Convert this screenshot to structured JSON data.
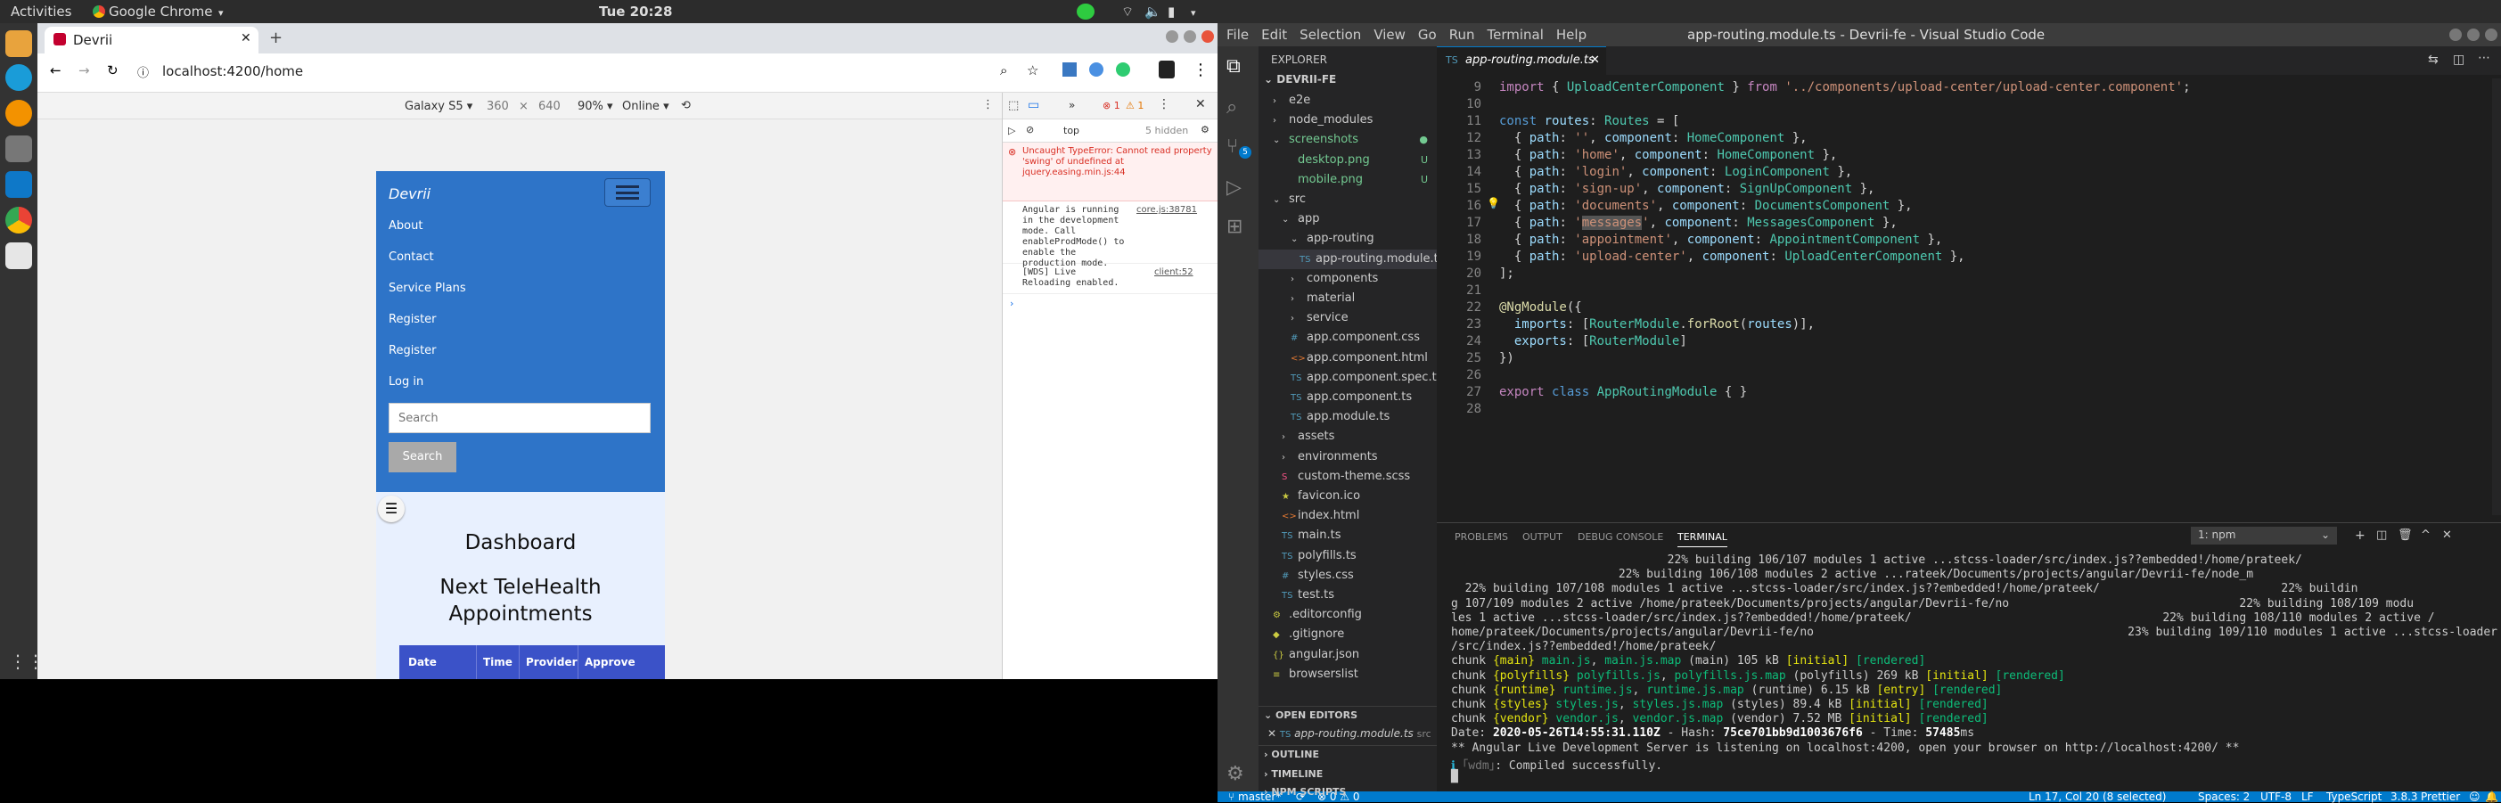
{
  "system": {
    "activities": "Activities",
    "app_name": "Google Chrome",
    "clock": "Tue 20:28"
  },
  "browser": {
    "tab_title": "Devrii",
    "url": "localhost:4200/home",
    "device": {
      "name": "Galaxy S5",
      "width": "360",
      "x": "×",
      "height": "640",
      "zoom": "90%",
      "network": "Online"
    },
    "devtools": {
      "context": "top",
      "hidden": "5 hidden",
      "errors": "1",
      "warnings": "1",
      "messages": [
        {
          "text": "Uncaught TypeError: Cannot read property 'swing' of undefined at jquery.easing.min.js:44",
          "source": "jquery.easing.min.js:44"
        },
        {
          "text": "Angular is running in the development mode. Call enableProdMode() to enable the production mode.",
          "source": "core.js:38781"
        },
        {
          "text": "[WDS] Live Reloading enabled.",
          "source": "client:52"
        }
      ]
    }
  },
  "app": {
    "brand": "Devrii",
    "nav": [
      "About",
      "Contact",
      "Service Plans",
      "Register",
      "Register",
      "Log in"
    ],
    "search_placeholder": "Search",
    "search_button": "Search",
    "dashboard_title": "Dashboard",
    "section_title_1": "Next TeleHealth",
    "section_title_2": "Appointments",
    "table_headers": [
      "Date",
      "Time",
      "Provider",
      "Approve"
    ]
  },
  "vscode": {
    "title": "app-routing.module.ts - Devrii-fe - Visual Studio Code",
    "menu": [
      "File",
      "Edit",
      "Selection",
      "View",
      "Go",
      "Run",
      "Terminal",
      "Help"
    ],
    "explorer_title": "EXPLORER",
    "project": "DEVRII-FE",
    "tree": [
      {
        "label": "e2e",
        "indent": 1,
        "type": "folder",
        "state": "closed"
      },
      {
        "label": "node_modules",
        "indent": 1,
        "type": "folder",
        "state": "closed"
      },
      {
        "label": "screenshots",
        "indent": 1,
        "type": "folder",
        "state": "open",
        "mark": "●",
        "color": "#73c991"
      },
      {
        "label": "desktop.png",
        "indent": 2,
        "type": "file",
        "mark": "U",
        "color": "#73c991"
      },
      {
        "label": "mobile.png",
        "indent": 2,
        "type": "file",
        "mark": "U",
        "color": "#73c991"
      },
      {
        "label": "src",
        "indent": 1,
        "type": "folder",
        "state": "open"
      },
      {
        "label": "app",
        "indent": 2,
        "type": "folder",
        "state": "open"
      },
      {
        "label": "app-routing",
        "indent": 3,
        "type": "folder",
        "state": "open"
      },
      {
        "label": "app-routing.module.ts",
        "indent": 4,
        "type": "file",
        "ext": "TS",
        "selected": true
      },
      {
        "label": "components",
        "indent": 3,
        "type": "folder",
        "state": "closed"
      },
      {
        "label": "material",
        "indent": 3,
        "type": "folder",
        "state": "closed"
      },
      {
        "label": "service",
        "indent": 3,
        "type": "folder",
        "state": "closed"
      },
      {
        "label": "app.component.css",
        "indent": 3,
        "type": "file",
        "ext": "#"
      },
      {
        "label": "app.component.html",
        "indent": 3,
        "type": "file",
        "ext": "<>"
      },
      {
        "label": "app.component.spec.ts",
        "indent": 3,
        "type": "file",
        "ext": "TS"
      },
      {
        "label": "app.component.ts",
        "indent": 3,
        "type": "file",
        "ext": "TS"
      },
      {
        "label": "app.module.ts",
        "indent": 3,
        "type": "file",
        "ext": "TS"
      },
      {
        "label": "assets",
        "indent": 2,
        "type": "folder",
        "state": "closed"
      },
      {
        "label": "environments",
        "indent": 2,
        "type": "folder",
        "state": "closed"
      },
      {
        "label": "custom-theme.scss",
        "indent": 2,
        "type": "file",
        "ext": "S"
      },
      {
        "label": "favicon.ico",
        "indent": 2,
        "type": "file",
        "ext": "★"
      },
      {
        "label": "index.html",
        "indent": 2,
        "type": "file",
        "ext": "<>"
      },
      {
        "label": "main.ts",
        "indent": 2,
        "type": "file",
        "ext": "TS"
      },
      {
        "label": "polyfills.ts",
        "indent": 2,
        "type": "file",
        "ext": "TS"
      },
      {
        "label": "styles.css",
        "indent": 2,
        "type": "file",
        "ext": "#"
      },
      {
        "label": "test.ts",
        "indent": 2,
        "type": "file",
        "ext": "TS"
      },
      {
        "label": ".editorconfig",
        "indent": 1,
        "type": "file",
        "ext": "⚙"
      },
      {
        "label": ".gitignore",
        "indent": 1,
        "type": "file",
        "ext": "◆"
      },
      {
        "label": "angular.json",
        "indent": 1,
        "type": "file",
        "ext": "{}"
      },
      {
        "label": "browserslist",
        "indent": 1,
        "type": "file",
        "ext": "≡"
      }
    ],
    "open_editors": "OPEN EDITORS",
    "open_file": "app-routing.module.ts",
    "open_file_path": "src",
    "outline": "OUTLINE",
    "timeline": "TIMELINE",
    "npm_scripts": "NPM SCRIPTS",
    "active_tab": "app-routing.module.ts",
    "code_lines": [
      {
        "n": "9",
        "t": "import { UploadCenterComponent } from '../components/upload-center/upload-center.component';"
      },
      {
        "n": "10",
        "t": ""
      },
      {
        "n": "11",
        "t": "const routes: Routes = ["
      },
      {
        "n": "12",
        "t": "  { path: '', component: HomeComponent },"
      },
      {
        "n": "13",
        "t": "  { path: 'home', component: HomeComponent },"
      },
      {
        "n": "14",
        "t": "  { path: 'login', component: LoginComponent },"
      },
      {
        "n": "15",
        "t": "  { path: 'sign-up', component: SignUpComponent },"
      },
      {
        "n": "16",
        "t": "  { path: 'documents', component: DocumentsComponent },"
      },
      {
        "n": "17",
        "t": "  { path: 'messages', component: MessagesComponent },"
      },
      {
        "n": "18",
        "t": "  { path: 'appointment', component: AppointmentComponent },"
      },
      {
        "n": "19",
        "t": "  { path: 'upload-center', component: UploadCenterComponent },"
      },
      {
        "n": "20",
        "t": "];"
      },
      {
        "n": "21",
        "t": ""
      },
      {
        "n": "22",
        "t": "@NgModule({"
      },
      {
        "n": "23",
        "t": "  imports: [RouterModule.forRoot(routes)],"
      },
      {
        "n": "24",
        "t": "  exports: [RouterModule]"
      },
      {
        "n": "25",
        "t": "})"
      },
      {
        "n": "26",
        "t": ""
      },
      {
        "n": "27",
        "t": "export class AppRoutingModule { }"
      },
      {
        "n": "28",
        "t": ""
      }
    ],
    "panel_tabs": [
      "PROBLEMS",
      "OUTPUT",
      "DEBUG CONSOLE",
      "TERMINAL"
    ],
    "terminal_select": "1: npm",
    "terminal_lines": [
      "                               22% building 106/107 modules 1 active ...stcss-loader/src/index.js??embedded!/home/prateek/",
      "                        22% building 106/108 modules 2 active ...rateek/Documents/projects/angular/Devrii-fe/node_m",
      "  22% building 107/108 modules 1 active ...stcss-loader/src/index.js??embedded!/home/prateek/                          22% buildin",
      "g 107/109 modules 2 active /home/prateek/Documents/projects/angular/Devrii-fe/no                                 22% building 108/109 modu",
      "les 1 active ...stcss-loader/src/index.js??embedded!/home/prateek/                                    22% building 108/110 modules 2 active /",
      "home/prateek/Documents/projects/angular/Devrii-fe/no                                             23% building 109/110 modules 1 active ...stcss-loader",
      "/src/index.js??embedded!/home/prateek/",
      "chunk {main} main.js, main.js.map (main) 105 kB [initial] [rendered]",
      "chunk {polyfills} polyfills.js, polyfills.js.map (polyfills) 269 kB [initial] [rendered]",
      "chunk {runtime} runtime.js, runtime.js.map (runtime) 6.15 kB [entry] [rendered]",
      "chunk {styles} styles.js, styles.js.map (styles) 89.4 kB [initial] [rendered]",
      "chunk {vendor} vendor.js, vendor.js.map (vendor) 7.52 MB [initial] [rendered]",
      "Date: 2020-05-26T14:55:31.110Z - Hash: 75ce701bb9d1003676f6 - Time: 57485ms",
      "** Angular Live Development Server is listening on localhost:4200, open your browser on http://localhost:4200/ **",
      "ℹ ｢wdm｣: Compiled successfully.",
      "█"
    ],
    "status_left": [
      "master*",
      "⟳",
      "⊗ 0 ⚠ 0"
    ],
    "status_right": [
      "Ln 17, Col 20 (8 selected)",
      "Spaces: 2",
      "UTF-8",
      "LF",
      "TypeScript",
      "3.8.3",
      "Prettier",
      "☺",
      "🔔"
    ]
  }
}
